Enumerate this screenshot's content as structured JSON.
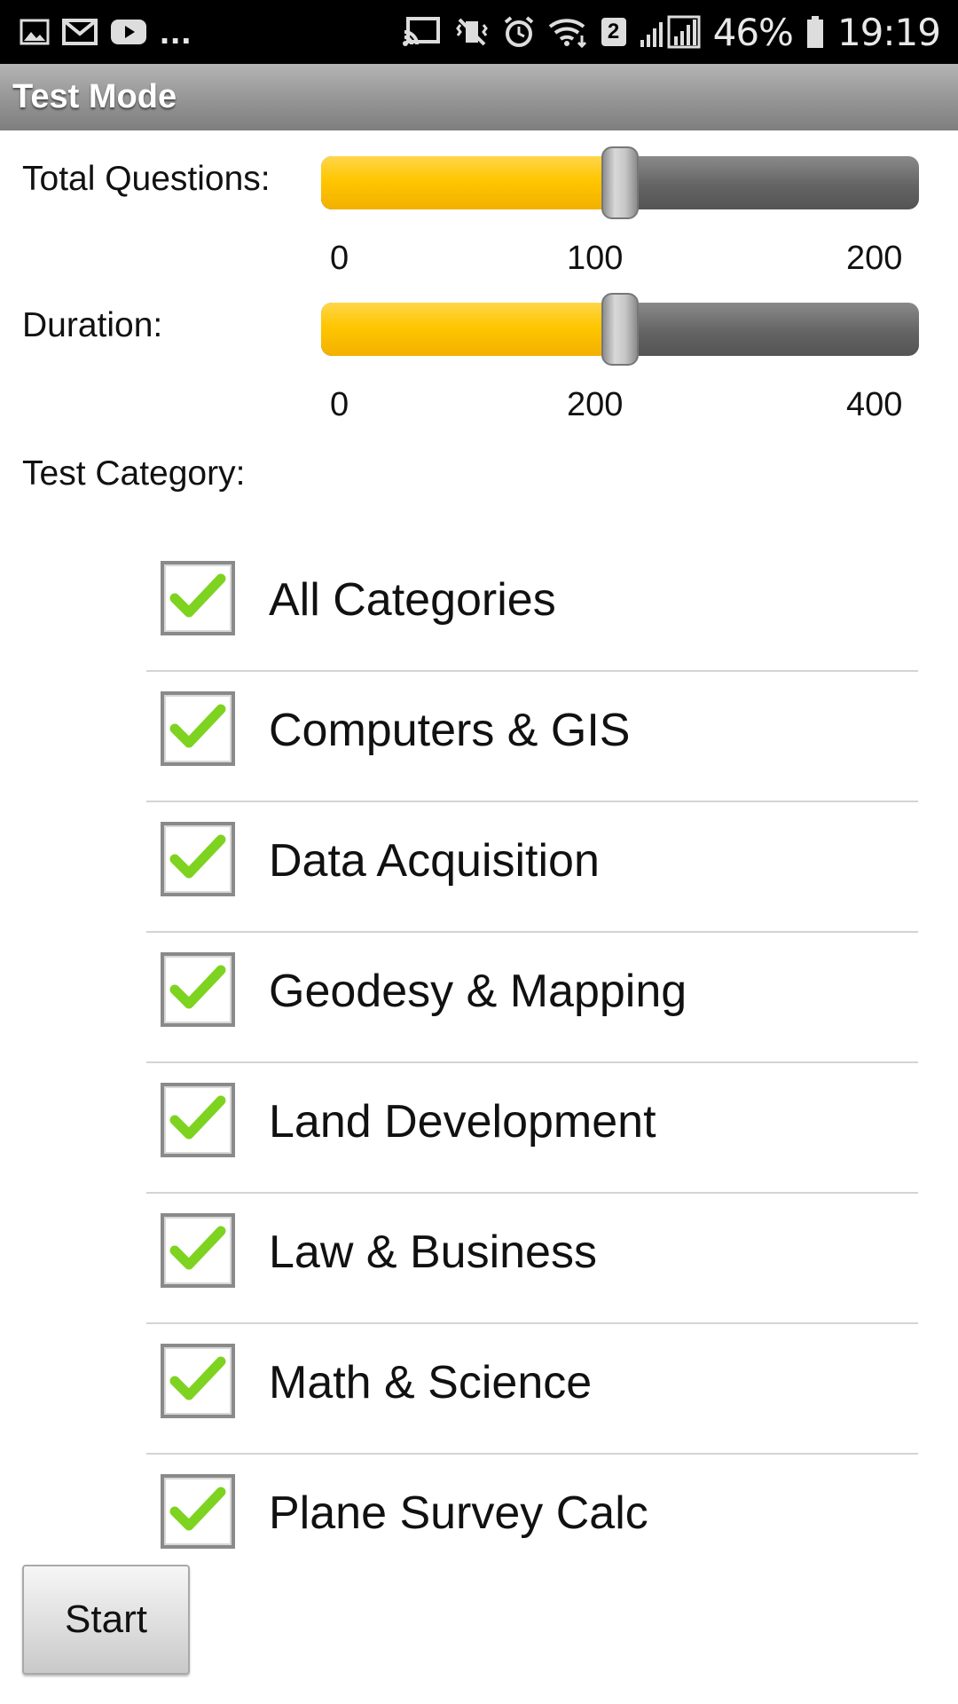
{
  "status_bar": {
    "battery": "46%",
    "time": "19:19",
    "wifi_badge": "2",
    "overflow": "...",
    "icons": [
      "image-icon",
      "gmail-icon",
      "youtube-icon",
      "cast-icon",
      "mute-vibrate-icon",
      "alarm-icon",
      "wifi-icon",
      "signal-icon",
      "battery-icon"
    ]
  },
  "title_bar": {
    "title": "Test Mode"
  },
  "total_questions": {
    "label": "Total Questions:",
    "value": 100,
    "min": 0,
    "max": 200,
    "ticks": [
      "0",
      "100",
      "200"
    ]
  },
  "duration": {
    "label": "Duration:",
    "value": 200,
    "min": 0,
    "max": 400,
    "ticks": [
      "0",
      "200",
      "400"
    ]
  },
  "test_category": {
    "label": "Test Category:",
    "items": [
      {
        "label": "All Categories",
        "checked": true
      },
      {
        "label": "Computers & GIS",
        "checked": true
      },
      {
        "label": "Data Acquisition",
        "checked": true
      },
      {
        "label": "Geodesy & Mapping",
        "checked": true
      },
      {
        "label": "Land Development",
        "checked": true
      },
      {
        "label": "Law & Business",
        "checked": true
      },
      {
        "label": "Math & Science",
        "checked": true
      },
      {
        "label": "Plane Survey Calc",
        "checked": true
      }
    ]
  },
  "start_button": {
    "label": "Start"
  },
  "colors": {
    "accent": "#ffc600",
    "track": "#646464",
    "check": "#7ed321",
    "title_bar": "#9a9a9a"
  }
}
